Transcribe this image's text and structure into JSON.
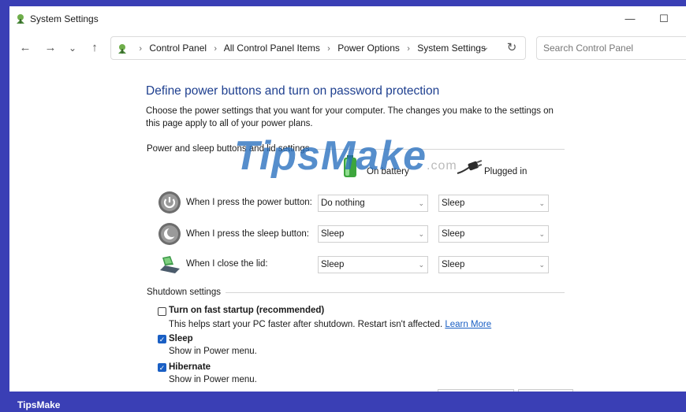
{
  "window": {
    "title": "System Settings",
    "minimize_glyph": "—",
    "maximize_glyph": "☐"
  },
  "nav": {
    "back_glyph": "←",
    "forward_glyph": "→",
    "recent_glyph": "⌄",
    "up_glyph": "↑",
    "breadcrumbs": [
      "Control Panel",
      "All Control Panel Items",
      "Power Options",
      "System Settings"
    ],
    "search_placeholder": "Search Control Panel"
  },
  "page": {
    "heading": "Define power buttons and turn on password protection",
    "description": "Choose the power settings that you want for your computer. The changes you make to the settings on this page apply to all of your power plans."
  },
  "power_group": {
    "title": "Power and sleep buttons and lid settings",
    "col_battery": "On battery",
    "col_plugged": "Plugged in",
    "rows": [
      {
        "label": "When I press the power button:",
        "battery": "Do nothing",
        "plugged": "Sleep",
        "icon": "power-button-icon"
      },
      {
        "label": "When I press the sleep button:",
        "battery": "Sleep",
        "plugged": "Sleep",
        "icon": "sleep-button-icon"
      },
      {
        "label": "When I close the lid:",
        "battery": "Sleep",
        "plugged": "Sleep",
        "icon": "laptop-lid-icon"
      }
    ]
  },
  "shutdown_group": {
    "title": "Shutdown settings",
    "items": [
      {
        "label": "Turn on fast startup (recommended)",
        "checked": false,
        "description": "This helps start your PC faster after shutdown. Restart isn't affected.",
        "link": "Learn More"
      },
      {
        "label": "Sleep",
        "checked": true,
        "description": "Show in Power menu."
      },
      {
        "label": "Hibernate",
        "checked": true,
        "description": "Show in Power menu."
      }
    ]
  },
  "watermark": {
    "text": "TipsMake",
    "suffix": ".com"
  },
  "brand": "TipsMake",
  "colors": {
    "accent": "#1a5fc4",
    "heading": "#1e3f8f",
    "frame": "#3a3fb5"
  }
}
